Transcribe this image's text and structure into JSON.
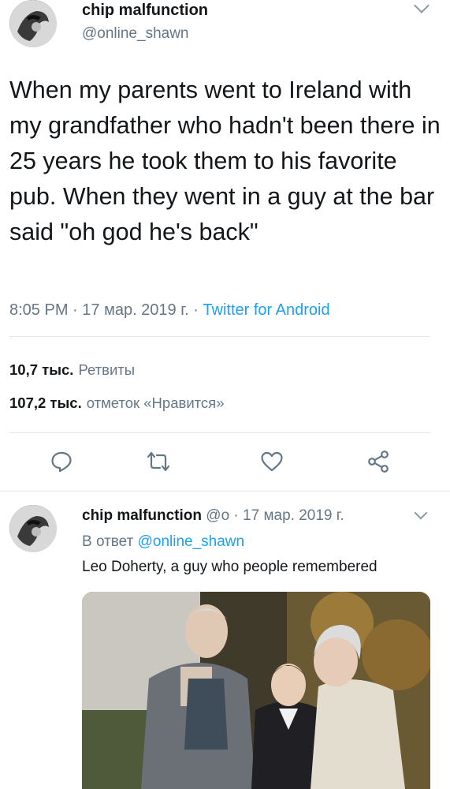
{
  "tweet": {
    "user": {
      "name": "chip malfunction",
      "handle": "@online_shawn",
      "avatar_icon": "avatar-icon"
    },
    "text": "When my parents went to Ireland with my grandfather who hadn't been there in 25 years he took them to his favorite pub. When they went in a guy at the bar said \"oh god he's back\"",
    "time": "8:05 PM",
    "date": "17 мар. 2019 г.",
    "source": "Twitter for Android",
    "retweets": {
      "count": "10,7 тыс.",
      "label": "Ретвиты"
    },
    "likes": {
      "count": "107,2 тыс.",
      "label": "отметок «Нравится»"
    },
    "actions": [
      "reply-icon",
      "retweet-icon",
      "like-icon",
      "share-icon"
    ]
  },
  "reply": {
    "user": {
      "name": "chip malfunction",
      "handle": "@o",
      "avatar_icon": "avatar-icon"
    },
    "date": "17 мар. 2019 г.",
    "replying_to_label": "В ответ",
    "replying_to": "@online_shawn",
    "text": "Leo Doherty, a guy who people remembered",
    "media": "photo of an older man, a boy in a suit and an older woman standing outdoors"
  },
  "colors": {
    "accent": "#1da1f2",
    "secondary_text": "#657786",
    "primary_text": "#14171a",
    "divider": "#e1e8ed"
  }
}
